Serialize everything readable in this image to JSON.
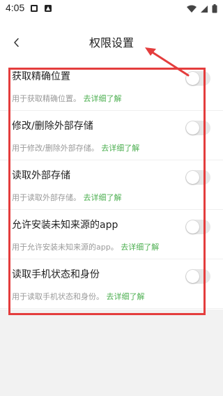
{
  "status_bar": {
    "time": "4:05",
    "icons_left": [
      "notification-icon",
      "image-icon"
    ],
    "icons_right": [
      "wifi-icon",
      "signal-icon",
      "battery-icon"
    ]
  },
  "header": {
    "back_icon": "chevron-left-icon",
    "title": "权限设置"
  },
  "settings": [
    {
      "title": "获取精确位置",
      "description": "用于获取精确位置。",
      "link": "去详细了解",
      "enabled": false
    },
    {
      "title": "修改/删除外部存储",
      "description": "用于修改/删除外部存储。",
      "link": "去详细了解",
      "enabled": false
    },
    {
      "title": "读取外部存储",
      "description": "用于读取外部存储。",
      "link": "去详细了解",
      "enabled": false
    },
    {
      "title": "允许安装未知来源的app",
      "description": "用于允许安装未知来源的app。",
      "link": "去详细了解",
      "enabled": false
    },
    {
      "title": "读取手机状态和身份",
      "description": "用于读取手机状态和身份。",
      "link": "去详细了解",
      "enabled": false
    }
  ],
  "colors": {
    "link": "#4caf50",
    "annotation": "#e43d3d",
    "toggle_off": "#e7e7e7"
  }
}
